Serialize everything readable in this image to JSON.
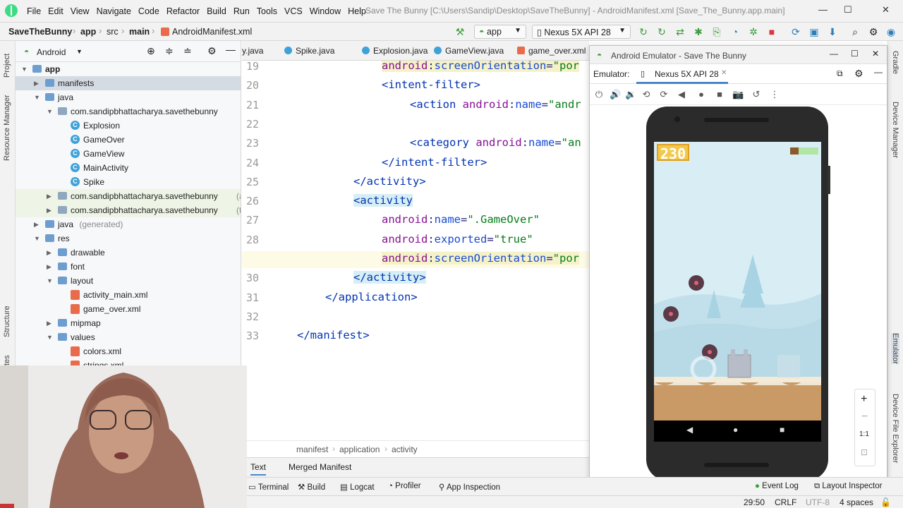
{
  "window": {
    "title": "Save The Bunny [C:\\Users\\Sandip\\Desktop\\SaveTheBunny] - AndroidManifest.xml [Save_The_Bunny.app.main]",
    "menu": [
      "File",
      "Edit",
      "View",
      "Navigate",
      "Code",
      "Refactor",
      "Build",
      "Run",
      "Tools",
      "VCS",
      "Window",
      "Help"
    ]
  },
  "breadcrumb": {
    "project": "SaveTheBunny",
    "module": "app",
    "src": "src",
    "set": "main",
    "file": "AndroidManifest.xml"
  },
  "toolbar": {
    "run_config": "app",
    "device": "Nexus 5X API 28"
  },
  "project_panel": {
    "view": "Android",
    "tree": [
      {
        "label": "app",
        "depth": 0,
        "open": true,
        "type": "module"
      },
      {
        "label": "manifests",
        "depth": 1,
        "open": false,
        "type": "folder",
        "selected": true
      },
      {
        "label": "java",
        "depth": 1,
        "open": true,
        "type": "folder"
      },
      {
        "label": "com.sandipbhattacharya.savethebunny",
        "depth": 2,
        "open": true,
        "type": "package"
      },
      {
        "label": "Explosion",
        "depth": 3,
        "type": "class"
      },
      {
        "label": "GameOver",
        "depth": 3,
        "type": "class"
      },
      {
        "label": "GameView",
        "depth": 3,
        "type": "class"
      },
      {
        "label": "MainActivity",
        "depth": 3,
        "type": "class"
      },
      {
        "label": "Spike",
        "depth": 3,
        "type": "class"
      },
      {
        "label": "com.sandipbhattacharya.savethebunny",
        "suffix": "(andro",
        "depth": 2,
        "open": false,
        "type": "package",
        "tint": true
      },
      {
        "label": "com.sandipbhattacharya.savethebunny",
        "suffix": "(test)",
        "depth": 2,
        "open": false,
        "type": "package",
        "tint": true
      },
      {
        "label": "java",
        "suffix": "(generated)",
        "depth": 1,
        "open": false,
        "type": "folder"
      },
      {
        "label": "res",
        "depth": 1,
        "open": true,
        "type": "folder"
      },
      {
        "label": "drawable",
        "depth": 2,
        "open": false,
        "type": "folder"
      },
      {
        "label": "font",
        "depth": 2,
        "open": false,
        "type": "folder"
      },
      {
        "label": "layout",
        "depth": 2,
        "open": true,
        "type": "folder"
      },
      {
        "label": "activity_main.xml",
        "depth": 3,
        "type": "xml"
      },
      {
        "label": "game_over.xml",
        "depth": 3,
        "type": "xml"
      },
      {
        "label": "mipmap",
        "depth": 2,
        "open": false,
        "type": "folder"
      },
      {
        "label": "values",
        "depth": 2,
        "open": true,
        "type": "folder"
      },
      {
        "label": "colors.xml",
        "depth": 3,
        "type": "xml"
      },
      {
        "label": "strings.xml",
        "depth": 3,
        "type": "xml"
      }
    ]
  },
  "editor_tabs": [
    "y.java",
    "Spike.java",
    "Explosion.java",
    "GameView.java",
    "game_over.xml"
  ],
  "code": [
    {
      "n": "19",
      "indent": 3,
      "parts": [
        [
          "kw",
          "android"
        ],
        [
          "p",
          ":"
        ],
        [
          "at",
          "screenOrientation"
        ],
        [
          "p",
          "="
        ],
        [
          "val",
          "\"por"
        ]
      ],
      "hl": "attr"
    },
    {
      "n": "20",
      "indent": 3,
      "parts": [
        [
          "tg",
          "<intent-filter>"
        ]
      ]
    },
    {
      "n": "21",
      "indent": 4,
      "parts": [
        [
          "tg",
          "<action "
        ],
        [
          "kw",
          "android"
        ],
        [
          "p",
          ":"
        ],
        [
          "at",
          "name"
        ],
        [
          "p",
          "="
        ],
        [
          "val",
          "\"andr"
        ]
      ]
    },
    {
      "n": "22",
      "indent": 0,
      "parts": []
    },
    {
      "n": "23",
      "indent": 4,
      "parts": [
        [
          "tg",
          "<category "
        ],
        [
          "kw",
          "android"
        ],
        [
          "p",
          ":"
        ],
        [
          "at",
          "name"
        ],
        [
          "p",
          "="
        ],
        [
          "val",
          "\"an"
        ]
      ]
    },
    {
      "n": "24",
      "indent": 3,
      "parts": [
        [
          "tg",
          "</intent-filter>"
        ]
      ]
    },
    {
      "n": "25",
      "indent": 2,
      "parts": [
        [
          "tg",
          "</activity>"
        ]
      ]
    },
    {
      "n": "26",
      "indent": 2,
      "parts": [
        [
          "tg",
          "<activity"
        ]
      ],
      "hl": "tag"
    },
    {
      "n": "27",
      "indent": 3,
      "parts": [
        [
          "kw",
          "android"
        ],
        [
          "p",
          ":"
        ],
        [
          "at",
          "name"
        ],
        [
          "p",
          "="
        ],
        [
          "val",
          "\".GameOver\""
        ]
      ]
    },
    {
      "n": "28",
      "indent": 3,
      "parts": [
        [
          "kw",
          "android"
        ],
        [
          "p",
          ":"
        ],
        [
          "at",
          "exported"
        ],
        [
          "p",
          "="
        ],
        [
          "val",
          "\"true\""
        ]
      ]
    },
    {
      "n": "29",
      "indent": 3,
      "parts": [
        [
          "kw",
          "android"
        ],
        [
          "p",
          ":"
        ],
        [
          "at",
          "screenOrientation"
        ],
        [
          "p",
          "="
        ],
        [
          "val",
          "\"por"
        ]
      ],
      "hl": "attr",
      "current": true
    },
    {
      "n": "30",
      "indent": 2,
      "parts": [
        [
          "tg",
          "</activity>"
        ]
      ],
      "hl": "tag"
    },
    {
      "n": "31",
      "indent": 1,
      "parts": [
        [
          "tg",
          "</application>"
        ]
      ]
    },
    {
      "n": "32",
      "indent": 0,
      "parts": []
    },
    {
      "n": "33",
      "indent": 0,
      "parts": [
        [
          "tg",
          "</manifest>"
        ]
      ]
    }
  ],
  "editor_breadcrumb": [
    "manifest",
    "application",
    "activity"
  ],
  "editor_modes": [
    "Text",
    "Merged Manifest"
  ],
  "bottom_tools": [
    "Terminal",
    "Build",
    "Logcat",
    "Profiler",
    "App Inspection",
    "Event Log",
    "Layout Inspector"
  ],
  "status": {
    "position": "29:50",
    "line_sep": "CRLF",
    "encoding": "UTF-8",
    "indent": "4 spaces"
  },
  "left_strip": [
    "Project",
    "Resource Manager",
    "Structure",
    "tes"
  ],
  "right_strip": [
    "Gradle",
    "Device Manager",
    "Emulator",
    "Device File Explorer"
  ],
  "emulator": {
    "title": "Android Emulator - Save The Bunny",
    "label": "Emulator:",
    "tab": "Nexus 5X API 28",
    "zoom_label": "1:1",
    "game_score": "230"
  }
}
